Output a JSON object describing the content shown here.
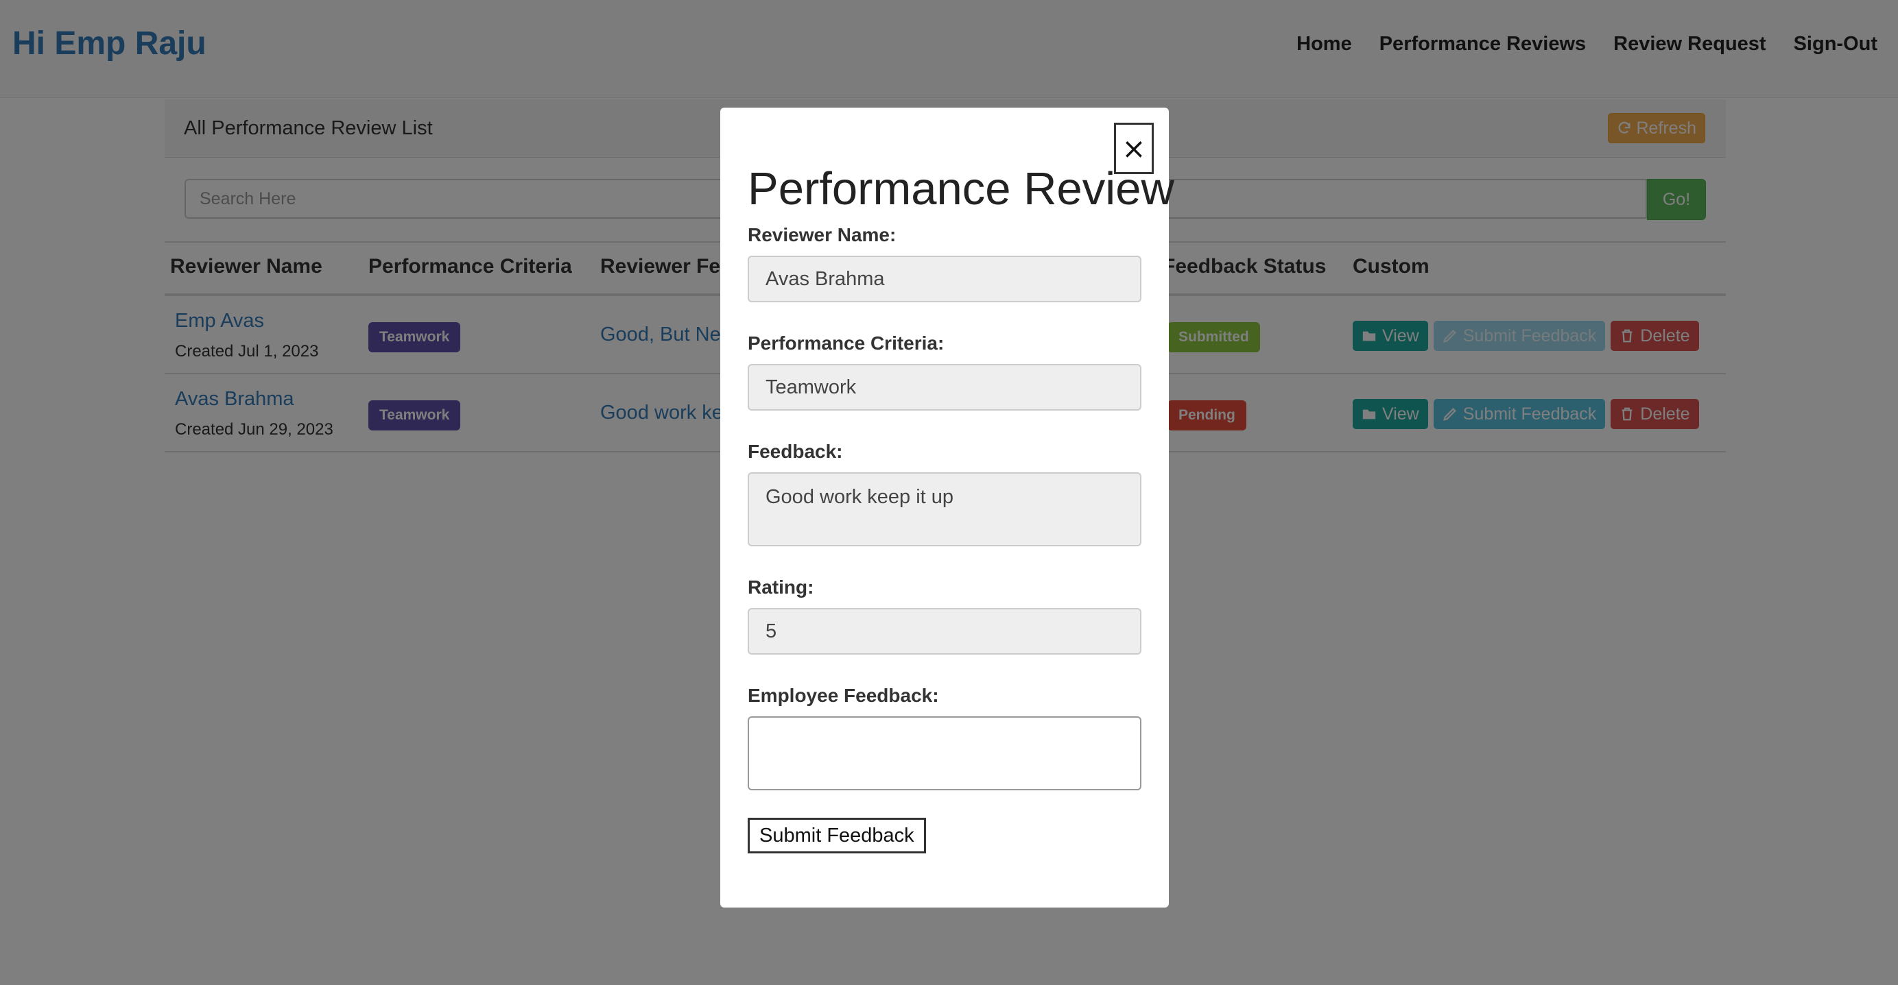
{
  "header": {
    "brand": "Hi Emp Raju",
    "nav": [
      "Home",
      "Performance Reviews",
      "Review Request",
      "Sign-Out"
    ]
  },
  "panel": {
    "title": "All Performance Review List",
    "refresh_label": "Refresh",
    "search_placeholder": "Search Here",
    "go_label": "Go!"
  },
  "table": {
    "headers": [
      "Reviewer Name",
      "Performance Criteria",
      "Reviewer Fee",
      "Feedback Status",
      "Custom"
    ],
    "rows": [
      {
        "reviewer": "Emp Avas",
        "created": "Created Jul 1, 2023",
        "criteria": "Teamwork",
        "feedback": "Good, But Ne",
        "status": "Submitted",
        "view": "View",
        "submit": "Submit Feedback",
        "delete": "Delete"
      },
      {
        "reviewer": "Avas Brahma",
        "created": "Created Jun 29, 2023",
        "criteria": "Teamwork",
        "feedback": "Good work ke",
        "status": "Pending",
        "view": "View",
        "submit": "Submit Feedback",
        "delete": "Delete"
      }
    ]
  },
  "modal": {
    "close_label": "×",
    "title": "Performance Review",
    "reviewer_label": "Reviewer Name:",
    "reviewer_value": "Avas Brahma",
    "criteria_label": "Performance Criteria:",
    "criteria_value": "Teamwork",
    "feedback_label": "Feedback:",
    "feedback_value": "Good work keep it up",
    "rating_label": "Rating:",
    "rating_value": "5",
    "employee_feedback_label": "Employee Feedback:",
    "employee_feedback_value": "",
    "submit_label": "Submit Feedback"
  },
  "colors": {
    "brand": "#337ab7",
    "teamwork_badge": "#5e4ea8",
    "submitted_badge": "#8cc63f",
    "pending_badge": "#e74c3c",
    "refresh": "#f0ad4e",
    "go": "#5cb85c"
  },
  "icons": [
    "refresh-icon",
    "folder-icon",
    "pencil-icon",
    "trash-icon",
    "close-icon"
  ]
}
